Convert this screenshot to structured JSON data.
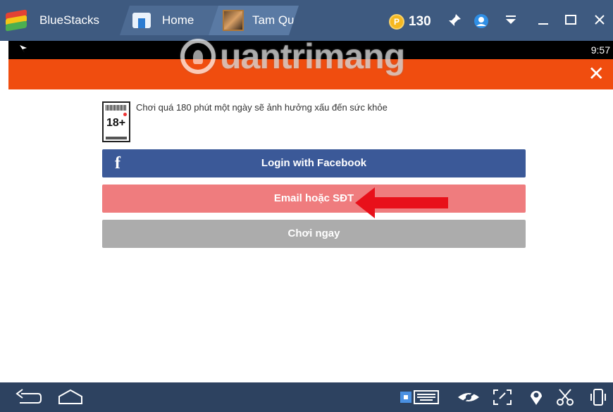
{
  "titlebar": {
    "app_name": "BlueStacks",
    "tab_home": "Home",
    "tab_game": "Tam Qu",
    "coins": "130",
    "coin_symbol": "P",
    "colors": {
      "background": "#3e5a80",
      "coin": "#f5b820"
    },
    "icons": [
      "pin-icon",
      "account-icon",
      "notification-icon",
      "minimize-icon",
      "maximize-icon",
      "close-icon"
    ]
  },
  "statusbar": {
    "time": "9:57"
  },
  "header": {
    "watermark": "uantrimang",
    "close_glyph": "✕",
    "color": "#f04d0f"
  },
  "content": {
    "age_rating": "18+",
    "warning": "Chơi quá 180 phút một ngày sẽ ảnh hưởng xấu đến sức khỏe",
    "buttons": {
      "facebook_icon": "f",
      "facebook": "Login with Facebook",
      "email": "Email hoặc SĐT",
      "play": "Chơi ngay"
    },
    "colors": {
      "facebook": "#3b5998",
      "email": "#ef7c7e",
      "play": "#acacac",
      "arrow": "#e8101a"
    }
  },
  "navbar": {
    "icons": [
      "back-icon",
      "home-icon",
      "keyboard-icon",
      "visibility-icon",
      "fullscreen-icon",
      "location-icon",
      "scissors-icon",
      "rotate-icon"
    ]
  }
}
